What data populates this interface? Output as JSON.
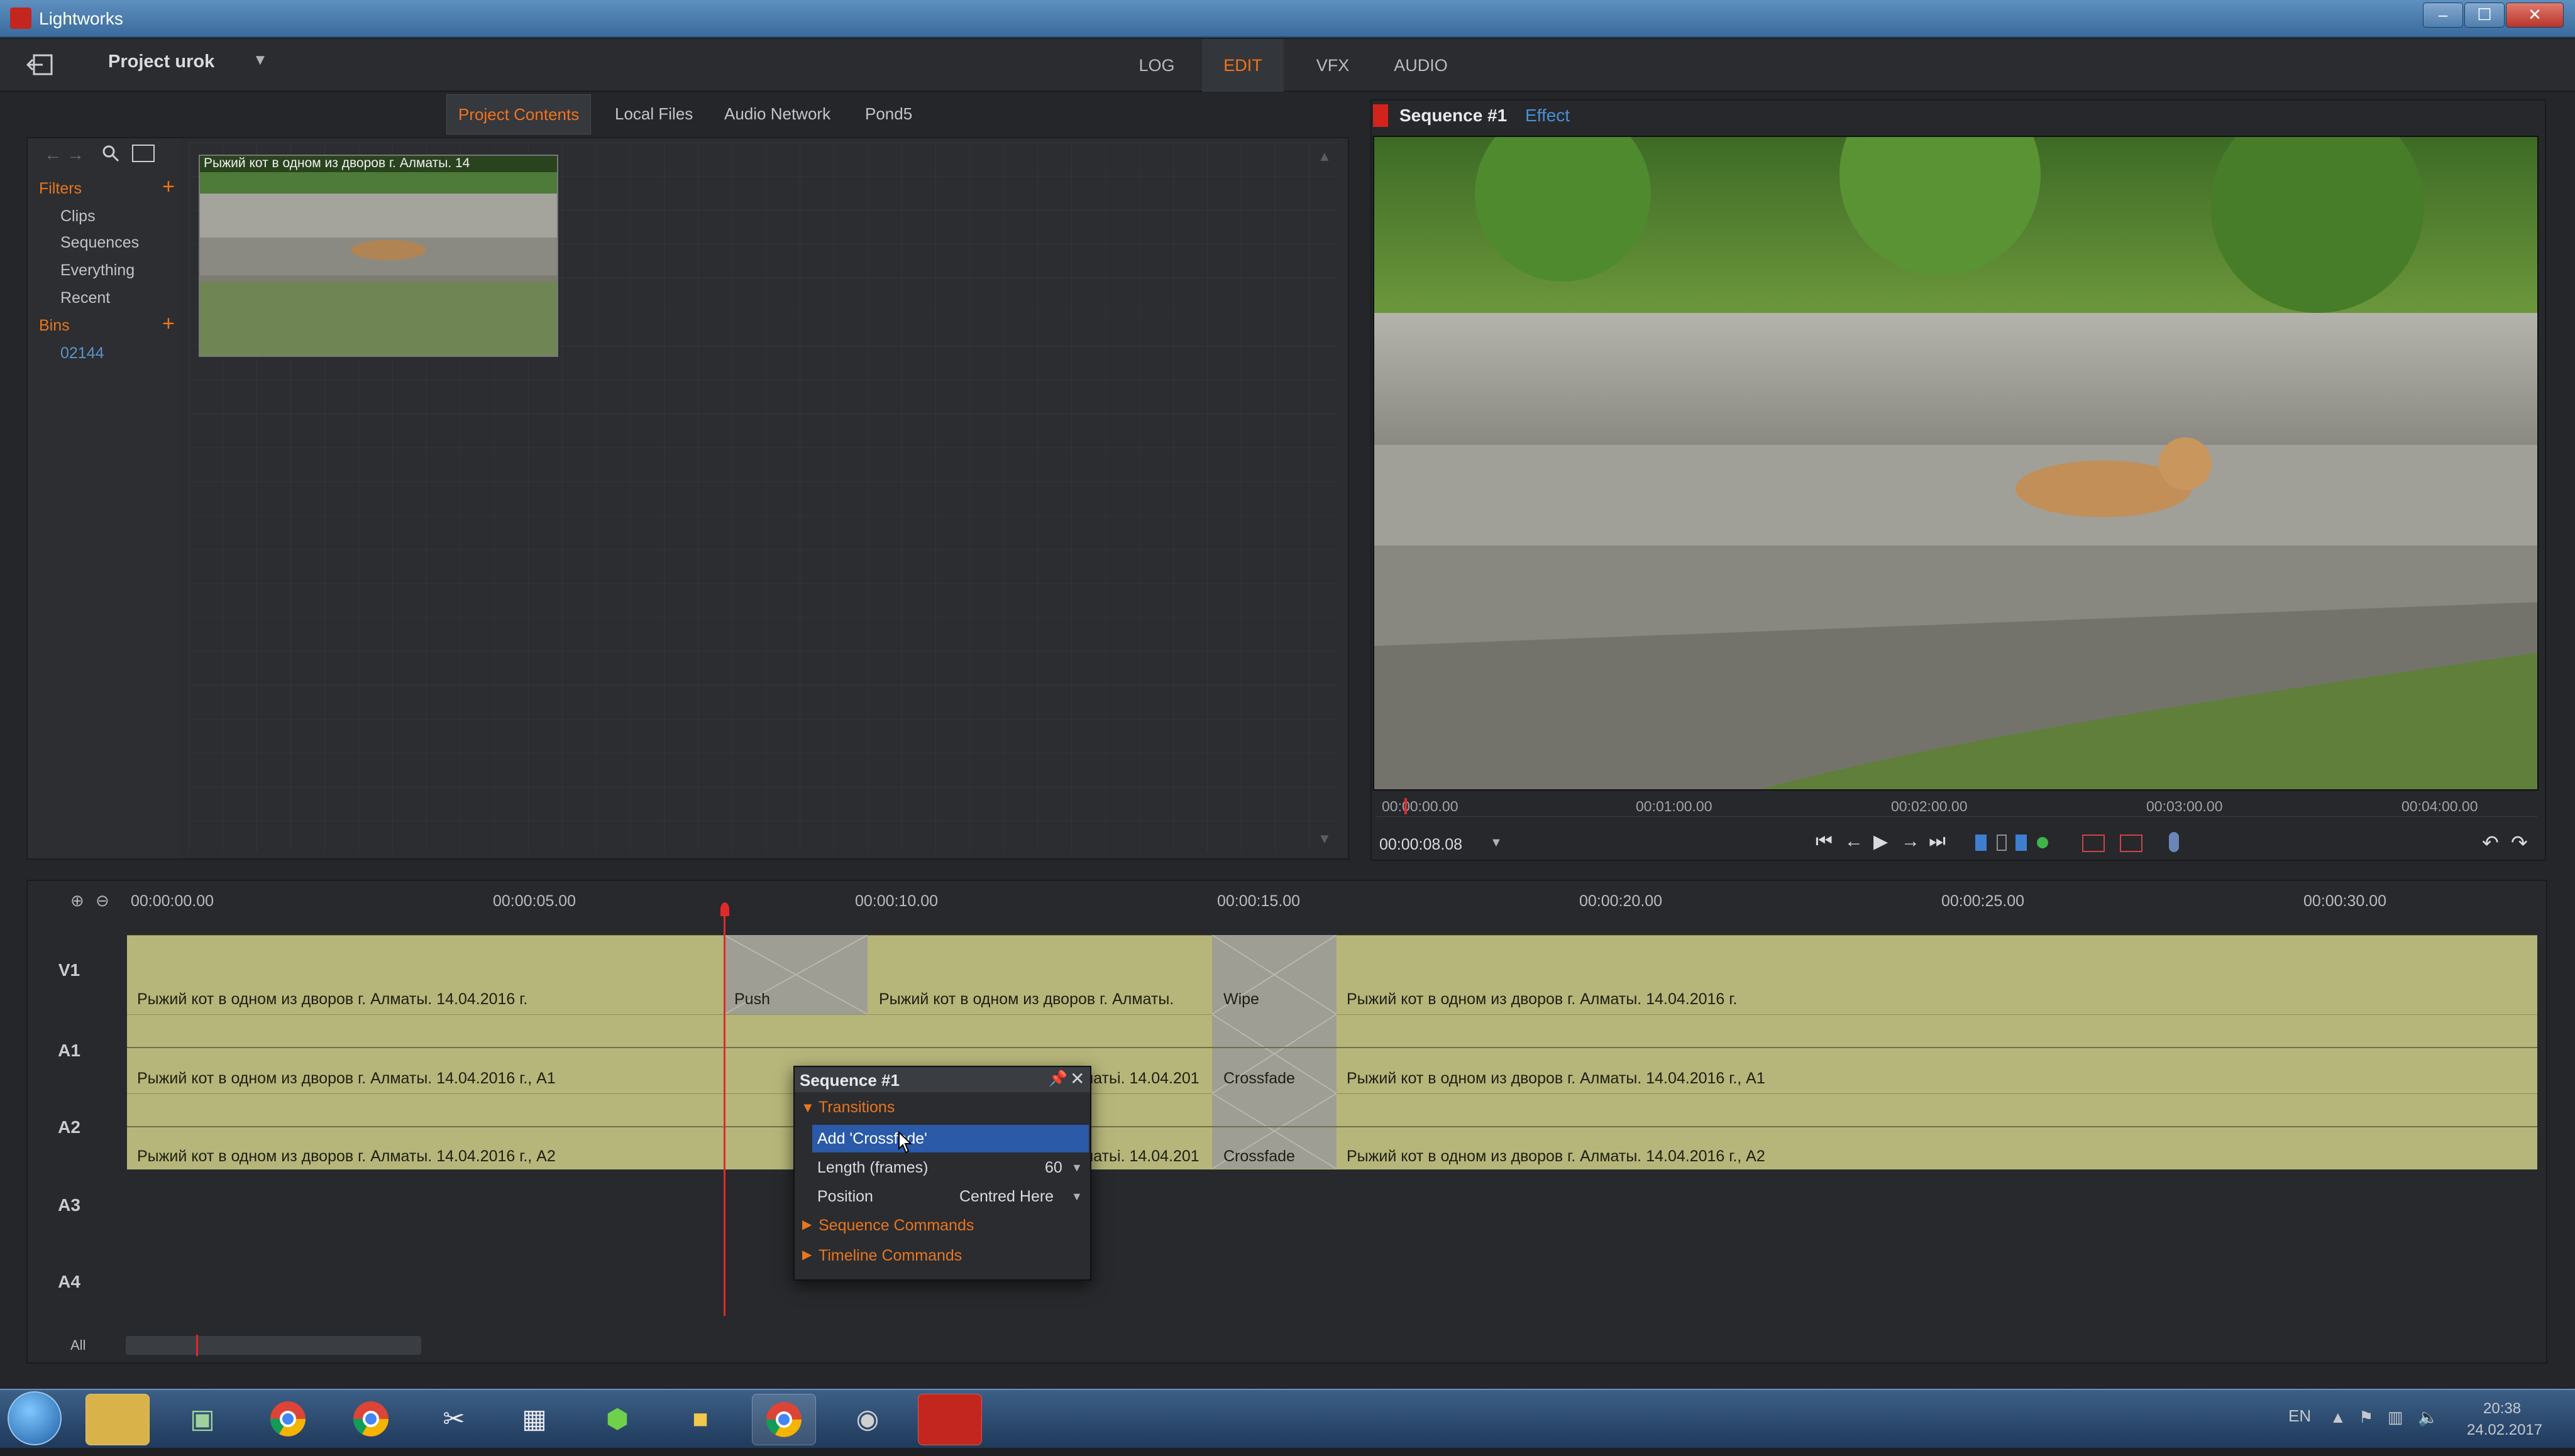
{
  "window": {
    "title": "Lightworks",
    "minimize": "–",
    "maximize": "☐",
    "close": "✕"
  },
  "topbar": {
    "project_name": "Project urok",
    "tabs": [
      "LOG",
      "EDIT",
      "VFX",
      "AUDIO"
    ],
    "active_tab": "EDIT"
  },
  "project_panel": {
    "tabs": [
      "Project Contents",
      "Local Files",
      "Audio Network",
      "Pond5"
    ],
    "active_tab": "Project Contents",
    "filters_label": "Filters",
    "filters": [
      "Clips",
      "Sequences",
      "Everything",
      "Recent"
    ],
    "bins_label": "Bins",
    "bins": [
      "02144"
    ],
    "thumbnail_title": "Рыжий кот в одном из дворов г. Алматы. 14"
  },
  "viewer": {
    "title": "Sequence #1",
    "effect_label": "Effect",
    "timecode": "00:00:08.08",
    "ruler": [
      "00:00:00.00",
      "00:01:00.00",
      "00:02:00.00",
      "00:03:00.00",
      "00:04:00.00"
    ]
  },
  "timeline": {
    "ruler": [
      "00:00:00.00",
      "00:00:05.00",
      "00:00:10.00",
      "00:00:15.00",
      "00:00:20.00",
      "00:00:25.00",
      "00:00:30.00"
    ],
    "tracks": [
      "V1",
      "A1",
      "A2",
      "A3",
      "A4"
    ],
    "v1_clips": [
      "Рыжий кот в одном из дворов г. Алматы. 14.04.2016 г.",
      "Рыжий кот в одном из дворов г. Алматы.",
      "Рыжий кот в одном из дворов г. Алматы. 14.04.2016 г."
    ],
    "v1_transitions": [
      "Push",
      "Wipe"
    ],
    "a1_clips": [
      "Рыжий кот в одном из дворов г. Алматы. 14.04.2016 г., A1",
      "матьі. 14.04.201",
      "Рыжий кот в одном из дворов г. Алматы. 14.04.2016 г., A1"
    ],
    "a2_clips": [
      "Рыжий кот в одном из дворов г. Алматы. 14.04.2016 г., A2",
      "матьі. 14.04.201",
      "Рыжий кот в одном из дворов г. Алматы. 14.04.2016 г., A2"
    ],
    "audio_transition": "Crossfade",
    "all_label": "All"
  },
  "context_menu": {
    "title": "Sequence #1",
    "section_transitions": "Transitions",
    "add_item": "Add 'Crossfade'",
    "length_label": "Length (frames)",
    "length_value": "60",
    "position_label": "Position",
    "position_value": "Centred Here",
    "section_sequence": "Sequence Commands",
    "section_timeline": "Timeline Commands"
  },
  "taskbar": {
    "lang": "EN",
    "time": "20:38",
    "date": "24.02.2017"
  },
  "colors": {
    "accent": "#f3731e",
    "clip": "#b6b67a",
    "transition": "#9f9e95",
    "playhead": "#e02a2a"
  }
}
